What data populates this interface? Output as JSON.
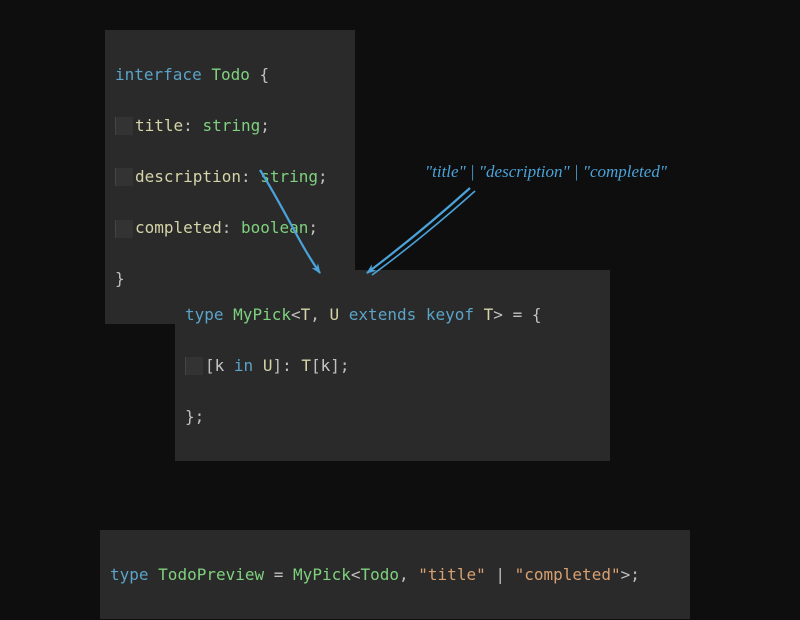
{
  "block1": {
    "line1": {
      "kw": "interface",
      "name": "Todo",
      "open": " {"
    },
    "line2": {
      "prop": "title",
      "colon": ": ",
      "type": "string",
      "semi": ";"
    },
    "line3": {
      "prop": "description",
      "colon": ": ",
      "type": "string",
      "semi": ";"
    },
    "line4": {
      "prop": "completed",
      "colon": ": ",
      "type": "boolean",
      "semi": ";"
    },
    "line5": {
      "close": "}"
    }
  },
  "block2": {
    "line1": {
      "kw": "type",
      "name": "MyPick",
      "lt": "<",
      "t": "T",
      "comma": ", ",
      "u": "U",
      "extends": " extends ",
      "keyof": "keyof ",
      "t2": "T",
      "gt": ">",
      "eq": " = {"
    },
    "line2": {
      "lb": "[",
      "k": "k",
      "in": " in ",
      "u": "U",
      "rb": "]",
      "colon": ": ",
      "t": "T",
      "lbr": "[",
      "k2": "k",
      "rbr": "]",
      "semi": ";"
    },
    "line3": {
      "close": "};"
    }
  },
  "block3": {
    "kw": "type",
    "name": "TodoPreview",
    "eq": " = ",
    "fn": "MyPick",
    "lt": "<",
    "arg1": "Todo",
    "comma": ", ",
    "s1": "\"title\"",
    "pipe": " | ",
    "s2": "\"completed\"",
    "gt": ">",
    "semi": ";"
  },
  "annotation": "\"title\" | \"description\" | \"completed\"",
  "colors": {
    "arrow": "#4aa3d9"
  }
}
